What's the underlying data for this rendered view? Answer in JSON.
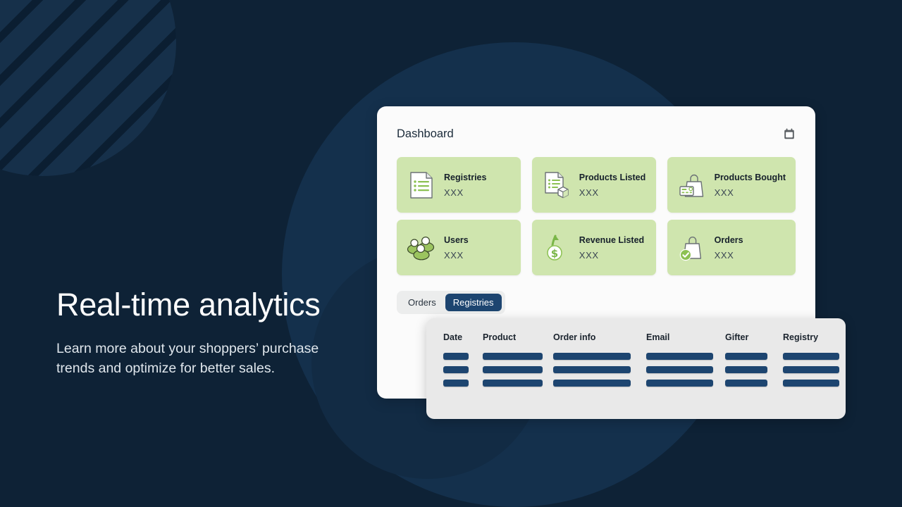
{
  "hero": {
    "title": "Real-time analytics",
    "subtitle": "Learn more about your shoppers’ purchase trends and optimize for better sales."
  },
  "dashboard": {
    "title": "Dashboard",
    "calendar_icon": "calendar-icon",
    "stats": [
      {
        "label": "Registries",
        "value": "XXX",
        "icon": "document-list-icon"
      },
      {
        "label": "Products Listed",
        "value": "XXX",
        "icon": "document-box-icon"
      },
      {
        "label": "Products Bought",
        "value": "XXX",
        "icon": "bag-card-icon"
      },
      {
        "label": "Users",
        "value": "XXX",
        "icon": "users-icon"
      },
      {
        "label": "Revenue Listed",
        "value": "XXX",
        "icon": "dollar-coin-arrow-icon"
      },
      {
        "label": "Orders",
        "value": "XXX",
        "icon": "bag-check-icon"
      }
    ],
    "tabs": [
      {
        "label": "Orders",
        "active": false
      },
      {
        "label": "Registries",
        "active": true
      }
    ]
  },
  "table": {
    "columns": [
      "Date",
      "Product",
      "Order info",
      "Email",
      "Gifter",
      "Registry"
    ],
    "row_count": 3
  },
  "colors": {
    "background": "#0e2236",
    "panel": "#fbfbfb",
    "stat_card": "#cfe5ae",
    "accent_navy": "#1d4570",
    "table_panel": "#e9e9e9",
    "hero_title": "#ffffff",
    "hero_subtitle": "#dfe6ec"
  }
}
